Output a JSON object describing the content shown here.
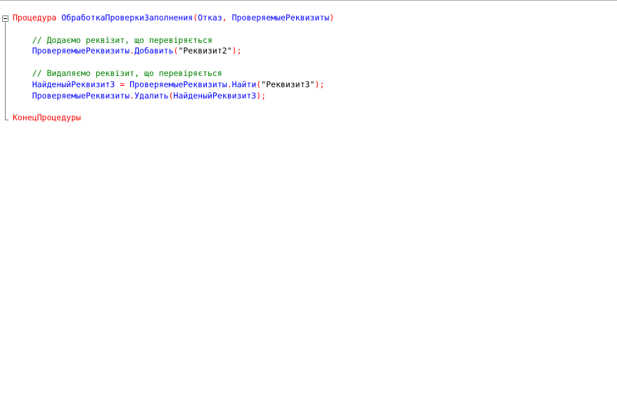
{
  "editor": {
    "lines": [
      {
        "indent": "",
        "tokens": [
          {
            "t": "kw",
            "v": "Процедура"
          },
          {
            "t": "sp",
            "v": " "
          },
          {
            "t": "id",
            "v": "ОбработкаПроверкиЗаполнения"
          },
          {
            "t": "op",
            "v": "("
          },
          {
            "t": "id",
            "v": "Отказ"
          },
          {
            "t": "op",
            "v": ","
          },
          {
            "t": "sp",
            "v": " "
          },
          {
            "t": "id",
            "v": "ПроверяемыеРеквизиты"
          },
          {
            "t": "op",
            "v": ")"
          }
        ]
      },
      {
        "indent": "",
        "tokens": []
      },
      {
        "indent": "    ",
        "tokens": [
          {
            "t": "cm",
            "v": "// Додаємо реквізит, що перевіряється"
          }
        ]
      },
      {
        "indent": "    ",
        "tokens": [
          {
            "t": "id",
            "v": "ПроверяемыеРеквизиты"
          },
          {
            "t": "op",
            "v": "."
          },
          {
            "t": "id",
            "v": "Добавить"
          },
          {
            "t": "op",
            "v": "("
          },
          {
            "t": "st",
            "v": "\"Реквизит2\""
          },
          {
            "t": "op",
            "v": ");"
          }
        ]
      },
      {
        "indent": "",
        "tokens": []
      },
      {
        "indent": "    ",
        "tokens": [
          {
            "t": "cm",
            "v": "// Видаляємо реквізит, що перевіряється"
          }
        ]
      },
      {
        "indent": "    ",
        "tokens": [
          {
            "t": "id",
            "v": "НайденыйРеквизит3"
          },
          {
            "t": "sp",
            "v": " "
          },
          {
            "t": "op",
            "v": "="
          },
          {
            "t": "sp",
            "v": " "
          },
          {
            "t": "id",
            "v": "ПроверяемыеРеквизиты"
          },
          {
            "t": "op",
            "v": "."
          },
          {
            "t": "id",
            "v": "Найти"
          },
          {
            "t": "op",
            "v": "("
          },
          {
            "t": "st",
            "v": "\"Реквизит3\""
          },
          {
            "t": "op",
            "v": ");"
          }
        ]
      },
      {
        "indent": "    ",
        "tokens": [
          {
            "t": "id",
            "v": "ПроверяемыеРеквизиты"
          },
          {
            "t": "op",
            "v": "."
          },
          {
            "t": "id",
            "v": "Удалить"
          },
          {
            "t": "op",
            "v": "("
          },
          {
            "t": "id",
            "v": "НайденыйРеквизит3"
          },
          {
            "t": "op",
            "v": ");"
          }
        ]
      },
      {
        "indent": "",
        "tokens": []
      },
      {
        "indent": "",
        "tokens": [
          {
            "t": "kw",
            "v": "КонецПроцедуры"
          }
        ]
      }
    ]
  },
  "gutter": {
    "fold_icon": "fold-collapse-icon"
  }
}
